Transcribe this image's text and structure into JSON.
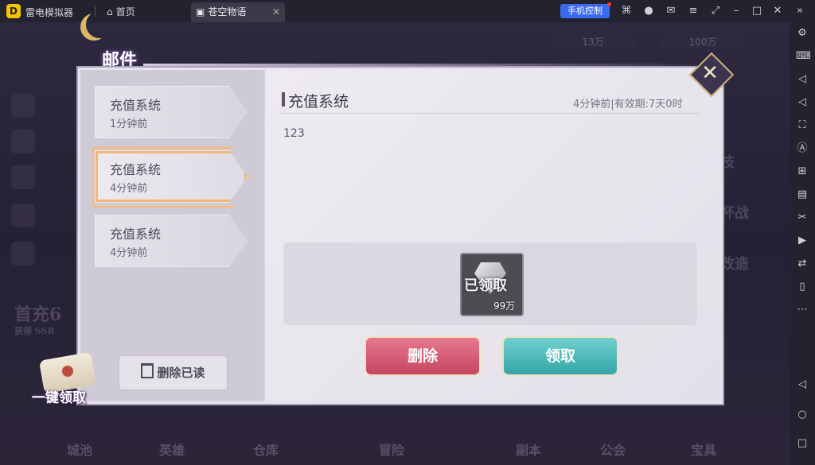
{
  "emulator": {
    "app_name": "雷电模拟器",
    "tabs": [
      {
        "label": "首页"
      },
      {
        "label": "苍空物语"
      }
    ],
    "phone_control_label": "手机控制",
    "close_tab_glyph": "✕"
  },
  "hud": {
    "resource_1": "13万",
    "resource_2": "100万",
    "first_charge": "首充6",
    "first_charge_sub": "获得 SSR",
    "side_texts": [
      "技",
      "杯战",
      "改造"
    ]
  },
  "bottom_nav": [
    "城池",
    "英雄",
    "仓库",
    "冒险",
    "副本",
    "公会",
    "宝具"
  ],
  "mail": {
    "title": "邮件",
    "items": [
      {
        "name": "充值系统",
        "time": "1分钟前"
      },
      {
        "name": "充值系统",
        "time": "4分钟前"
      },
      {
        "name": "充值系统",
        "time": "4分钟前"
      }
    ],
    "selected_index": 1,
    "detail": {
      "title": "充值系统",
      "meta": "4分钟前|有效期:7天0时",
      "body": "123",
      "reward": {
        "stamp": "已领取",
        "quantity": "99万"
      }
    },
    "delete_label": "删除",
    "claim_label": "领取",
    "delete_read_label": "删除已读",
    "one_key_claim_label": "一键领取"
  },
  "colors": {
    "delete_button": "#d85b75",
    "claim_button": "#4fbcbc",
    "selected_border": "#f5b774"
  }
}
